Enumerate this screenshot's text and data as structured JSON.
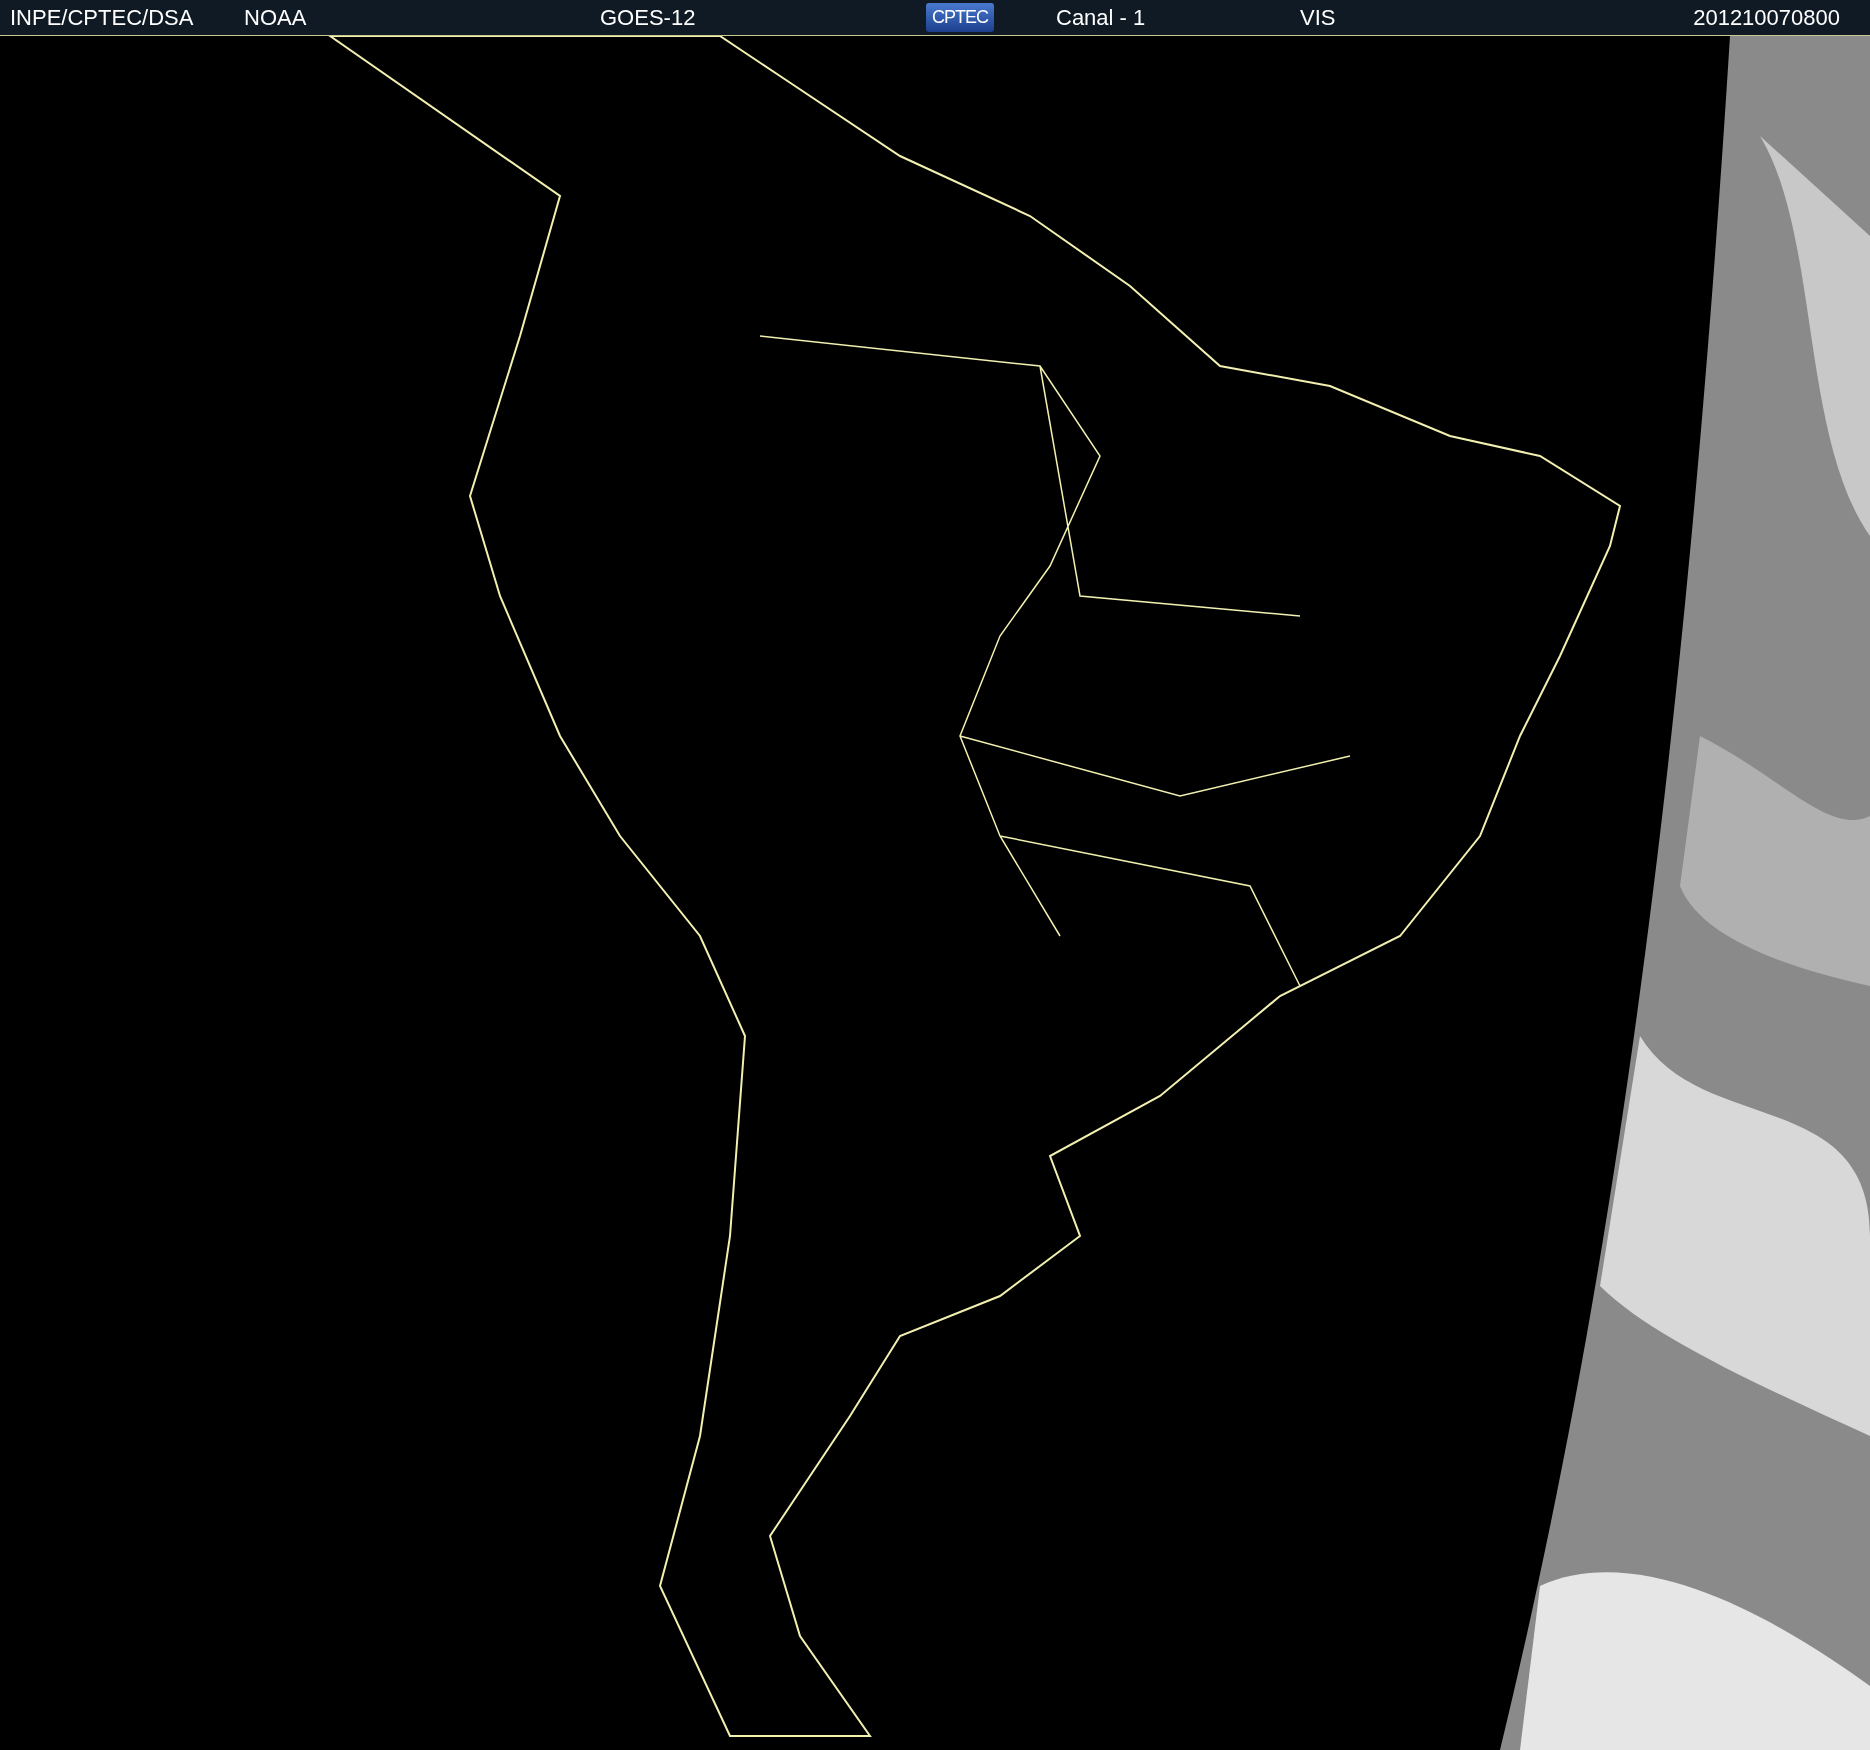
{
  "header": {
    "source": "INPE/CPTEC/DSA",
    "agency": "NOAA",
    "satellite": "GOES-12",
    "logo_text": "CPTEC",
    "channel": "Canal - 1",
    "band": "VIS",
    "timestamp": "201210070800"
  }
}
